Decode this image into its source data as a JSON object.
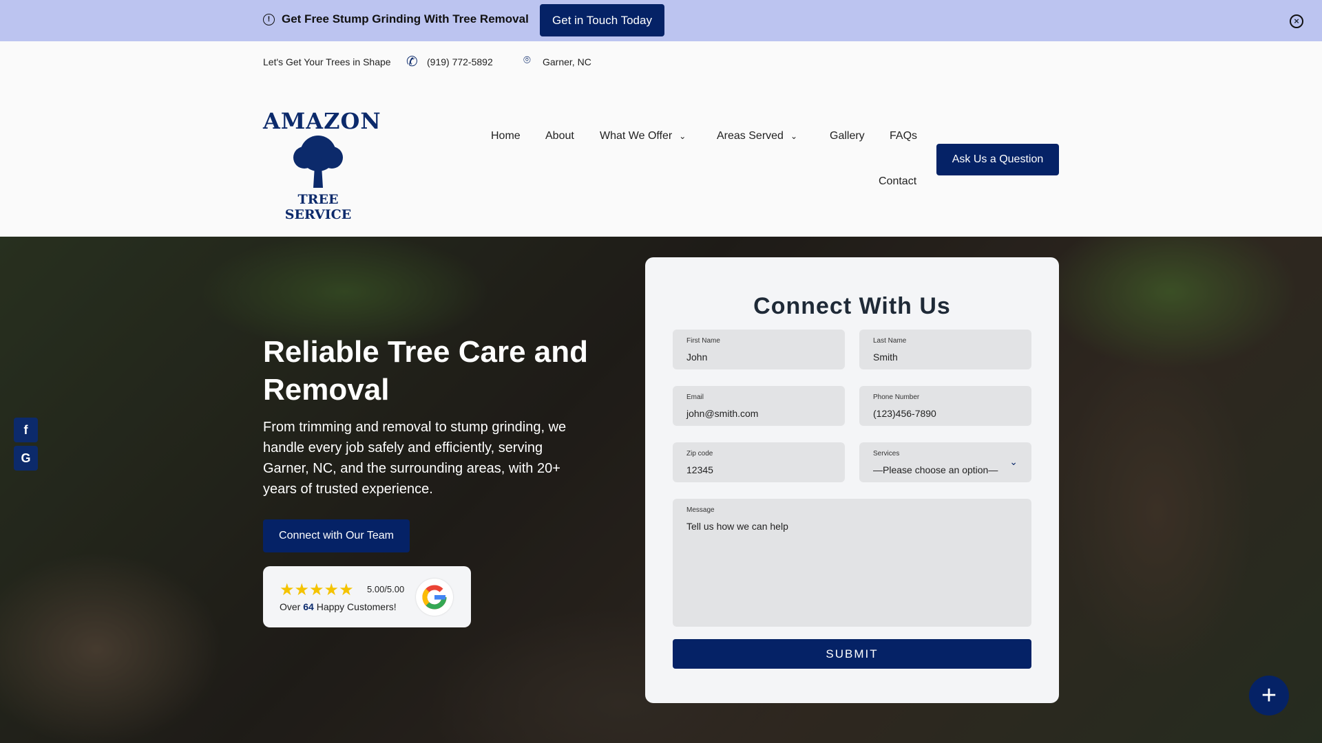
{
  "alert": {
    "message": "Get Free Stump Grinding With Tree Removal",
    "button": "Get in Touch Today"
  },
  "info": {
    "tagline": "Let's Get Your Trees in Shape",
    "phone": "(919) 772-5892",
    "location": "Garner, NC"
  },
  "logo": {
    "top": "AMAZON",
    "bottom": "TREE SERVICE"
  },
  "nav": {
    "home": "Home",
    "about": "About",
    "offer": "What We Offer",
    "areas": "Areas Served",
    "gallery": "Gallery",
    "faqs": "FAQs",
    "contact": "Contact",
    "ask": "Ask Us a Question"
  },
  "hero": {
    "title": "Reliable Tree Care and Removal",
    "text": "From trimming and removal to stump grinding, we handle every job safely and efficiently,  serving Garner, NC, and the surrounding areas, with 20+ years of trusted experience.",
    "cta": "Connect with Our Team"
  },
  "review": {
    "stars": "★★★★★",
    "rating_value": 5.0,
    "score": "5.00/5.00",
    "prefix": "Over",
    "count": "64",
    "suffix": "Happy Customers!"
  },
  "social": {
    "facebook": "f",
    "google": "G"
  },
  "form": {
    "title": "Connect With Us",
    "first_label": "First Name",
    "first_ph": "John",
    "last_label": "Last Name",
    "last_ph": "Smith",
    "email_label": "Email",
    "email_ph": "john@smith.com",
    "phone_label": "Phone Number",
    "phone_ph": "(123)456-7890",
    "zip_label": "Zip code",
    "zip_ph": "12345",
    "services_label": "Services",
    "services_value": "—Please choose an option—",
    "message_label": "Message",
    "message_ph": "Tell us how we can help",
    "submit": "SUBMIT"
  },
  "fab": "+"
}
